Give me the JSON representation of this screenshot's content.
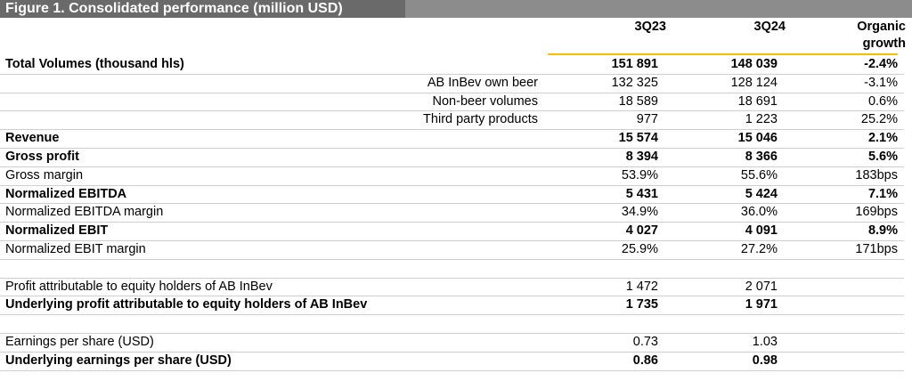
{
  "title": "Figure 1. Consolidated performance (million USD)",
  "columns": {
    "c1": "3Q23",
    "c2": "3Q24",
    "c3_line1": "Organic",
    "c3_line2": "growth"
  },
  "rows": [
    {
      "label": "Total Volumes (thousand hls)",
      "c1": "151 891",
      "c2": "148 039",
      "c3": "-2.4%",
      "bold": true,
      "indent": false
    },
    {
      "label": "AB InBev own beer",
      "c1": "132 325",
      "c2": "128 124",
      "c3": "-3.1%",
      "bold": false,
      "indent": true
    },
    {
      "label": "Non-beer volumes",
      "c1": "18 589",
      "c2": "18 691",
      "c3": "0.6%",
      "bold": false,
      "indent": true
    },
    {
      "label": "Third party products",
      "c1": "977",
      "c2": "1 223",
      "c3": "25.2%",
      "bold": false,
      "indent": true
    },
    {
      "label": "Revenue",
      "c1": "15 574",
      "c2": "15 046",
      "c3": "2.1%",
      "bold": true,
      "indent": false
    },
    {
      "label": "Gross profit",
      "c1": "8 394",
      "c2": "8 366",
      "c3": "5.6%",
      "bold": true,
      "indent": false
    },
    {
      "label": "Gross margin",
      "c1": "53.9%",
      "c2": "55.6%",
      "c3": "183bps",
      "bold": false,
      "indent": false
    },
    {
      "label": "Normalized EBITDA",
      "c1": "5 431",
      "c2": "5 424",
      "c3": "7.1%",
      "bold": true,
      "indent": false
    },
    {
      "label": "Normalized EBITDA margin",
      "c1": "34.9%",
      "c2": "36.0%",
      "c3": "169bps",
      "bold": false,
      "indent": false
    },
    {
      "label": "Normalized EBIT",
      "c1": "4 027",
      "c2": "4 091",
      "c3": "8.9%",
      "bold": true,
      "indent": false
    },
    {
      "label": "Normalized EBIT margin",
      "c1": "25.9%",
      "c2": "27.2%",
      "c3": "171bps",
      "bold": false,
      "indent": false
    },
    {
      "label": "",
      "c1": "",
      "c2": "",
      "c3": "",
      "bold": false,
      "indent": false
    },
    {
      "label": "Profit attributable to equity holders of AB InBev",
      "c1": "1 472",
      "c2": "2 071",
      "c3": "",
      "bold": false,
      "indent": false
    },
    {
      "label": "Underlying profit attributable to equity holders of AB InBev",
      "c1": "1 735",
      "c2": "1 971",
      "c3": "",
      "bold": true,
      "indent": false
    },
    {
      "label": "",
      "c1": "",
      "c2": "",
      "c3": "",
      "bold": false,
      "indent": false
    },
    {
      "label": "Earnings per share (USD)",
      "c1": "0.73",
      "c2": "1.03",
      "c3": "",
      "bold": false,
      "indent": false
    },
    {
      "label": "Underlying earnings per share (USD)",
      "c1": "0.86",
      "c2": "0.98",
      "c3": "",
      "bold": true,
      "indent": false
    }
  ]
}
